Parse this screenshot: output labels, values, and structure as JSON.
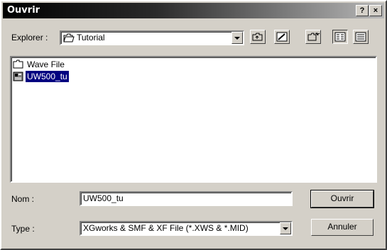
{
  "window": {
    "title": "Ouvrir"
  },
  "titlebar_buttons": {
    "help": "?",
    "close": "×"
  },
  "look_in": {
    "label": "Explorer :",
    "value": "Tutorial"
  },
  "files": [
    {
      "name": "Wave File",
      "icon": "folder-icon"
    },
    {
      "name": "UW500_tu",
      "icon": "project-file-icon",
      "selected": true
    }
  ],
  "filename": {
    "label": "Nom :",
    "value": "UW500_tu"
  },
  "filetype": {
    "label": "Type :",
    "value": "XGworks & SMF & XF File (*.XWS & *.MID)"
  },
  "buttons": {
    "open": "Ouvrir",
    "cancel": "Annuler"
  },
  "colors": {
    "titlebar": "#000000",
    "face": "#d4d0c8",
    "selection": "#000080"
  }
}
